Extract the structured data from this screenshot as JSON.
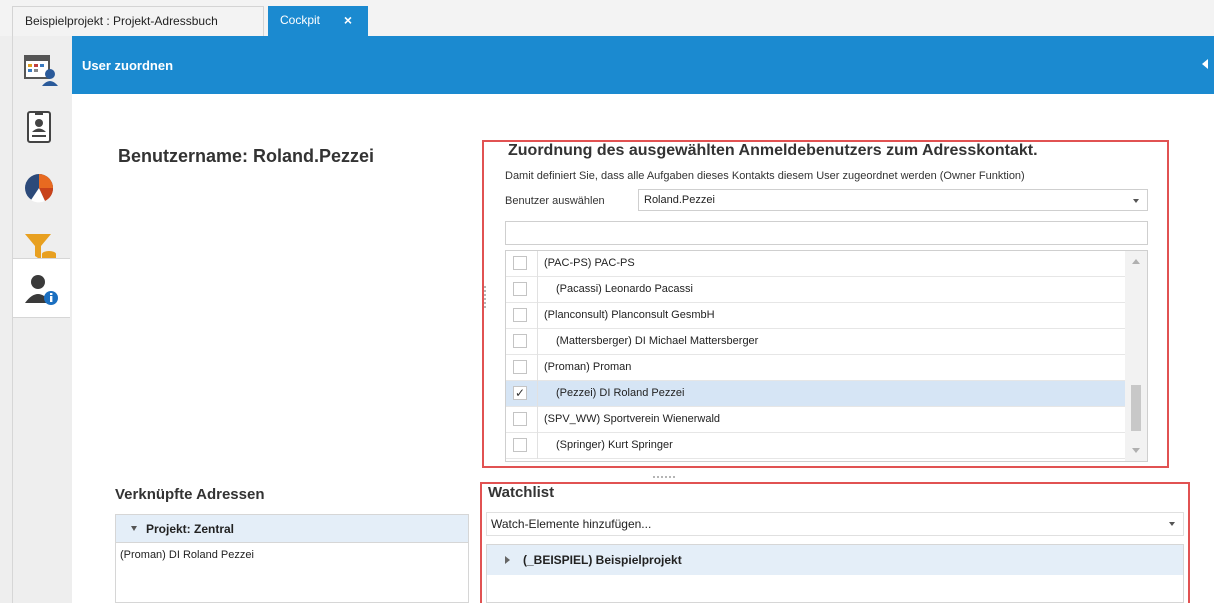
{
  "tabs": [
    {
      "label": "Beispielprojekt : Projekt-Adressbuch"
    },
    {
      "label": "Cockpit",
      "close": "×"
    }
  ],
  "nav": {
    "icons": [
      "calendar-user-icon",
      "contact-card-icon",
      "pie-chart-icon",
      "filter-database-icon",
      "user-info-icon"
    ],
    "active": "user-info-icon"
  },
  "header": {
    "title": "User zuordnen"
  },
  "username": "Benutzername: Roland.Pezzei",
  "assignment": {
    "title": "Zuordnung des ausgewählten Anmeldebenutzers zum Adresskontakt.",
    "description": "Damit definiert Sie, dass alle Aufgaben dieses Kontakts diesem User zugeordnet werden (Owner Funktion)",
    "select_label": "Benutzer auswählen",
    "select_value": "Roland.Pezzei",
    "filter_value": "",
    "rows": [
      {
        "label": "(PAC-PS) PAC-PS",
        "indent": 0,
        "checked": false,
        "selected": false
      },
      {
        "label": "(Pacassi) Leonardo Pacassi",
        "indent": 1,
        "checked": false,
        "selected": false
      },
      {
        "label": "(Planconsult) Planconsult GesmbH",
        "indent": 0,
        "checked": false,
        "selected": false
      },
      {
        "label": "(Mattersberger) DI Michael Mattersberger",
        "indent": 1,
        "checked": false,
        "selected": false
      },
      {
        "label": "(Proman) Proman",
        "indent": 0,
        "checked": false,
        "selected": false
      },
      {
        "label": "(Pezzei) DI Roland Pezzei",
        "indent": 1,
        "checked": true,
        "selected": true
      },
      {
        "label": "(SPV_WW) Sportverein Wienerwald",
        "indent": 0,
        "checked": false,
        "selected": false
      },
      {
        "label": "(Springer) Kurt Springer",
        "indent": 1,
        "checked": false,
        "selected": false
      }
    ],
    "check_glyph": "✓"
  },
  "linked": {
    "title": "Verknüpfte Adressen",
    "group": "Projekt: Zentral",
    "items": [
      "(Proman) DI Roland Pezzei"
    ]
  },
  "watchlist": {
    "title": "Watchlist",
    "combo_placeholder": "Watch-Elemente hinzufügen...",
    "group": "(_BEISPIEL) Beispielprojekt"
  },
  "colors": {
    "accent": "#1b8ad0",
    "highlight_box": "#e15252",
    "selected_row": "#d6e5f5",
    "group_header": "#e4eef8"
  }
}
